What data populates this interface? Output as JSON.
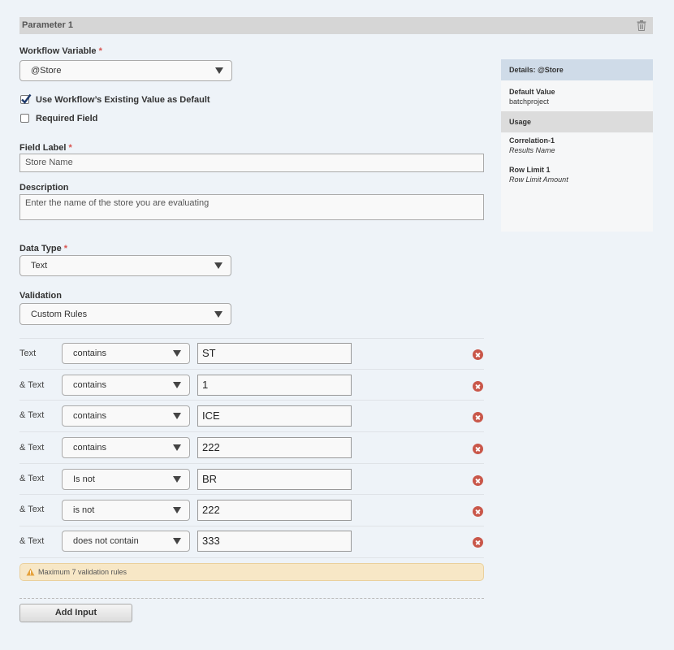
{
  "header": {
    "title": "Parameter 1"
  },
  "workflow_variable": {
    "label": "Workflow Variable",
    "required_mark": "*",
    "value": "@Store"
  },
  "checkboxes": [
    {
      "label": "Use Workflow’s Existing Value as Default",
      "checked": true
    },
    {
      "label": "Required Field",
      "checked": false
    }
  ],
  "field_label": {
    "label": "Field Label",
    "required_mark": "*",
    "value": "Store Name"
  },
  "description": {
    "label": "Description",
    "value": "Enter the name of the store you are evaluating"
  },
  "data_type": {
    "label": "Data Type",
    "required_mark": "*",
    "value": "Text"
  },
  "validation": {
    "label": "Validation",
    "value": "Custom Rules"
  },
  "rules": [
    {
      "label": "Text",
      "operator": "contains",
      "value": "ST"
    },
    {
      "label": "& Text",
      "operator": "contains",
      "value": "1"
    },
    {
      "label": "& Text",
      "operator": "contains",
      "value": "ICE"
    },
    {
      "label": "& Text",
      "operator": "contains",
      "value": "222"
    },
    {
      "label": "& Text",
      "operator": "Is not",
      "value": "BR"
    },
    {
      "label": "& Text",
      "operator": "is not",
      "value": "222"
    },
    {
      "label": "& Text",
      "operator": "does not contain",
      "value": "333"
    }
  ],
  "warning": {
    "text": "Maximum 7 validation rules"
  },
  "add_input": {
    "label": "Add Input"
  },
  "sidebar": {
    "details_title": "Details: @Store",
    "default_value_title": "Default Value",
    "default_value": "batchproject",
    "usage_title": "Usage",
    "usages": [
      {
        "name": "Correlation-1",
        "field": "Results Name"
      },
      {
        "name": "Row Limit 1",
        "field": "Row Limit Amount"
      }
    ]
  },
  "colors": {
    "background": "#eef3f8",
    "required": "#d9534f",
    "remove": "#c9574a",
    "warning_bg": "#f7e7c6",
    "details_header": "#cfdbe8"
  }
}
